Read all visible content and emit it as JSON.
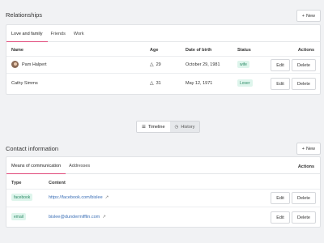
{
  "relationships": {
    "title": "Relationships",
    "new_label": "New",
    "tabs": [
      "Love and family",
      "Friends",
      "Work"
    ],
    "columns": [
      "Name",
      "Age",
      "Date of birth",
      "Status",
      "Actions"
    ],
    "rows": [
      {
        "name": "Pam Halpert",
        "age": "29",
        "dob": "October 29, 1981",
        "status": "wife",
        "edit": "Edit",
        "delete": "Delete"
      },
      {
        "name": "Cathy Simms",
        "age": "31",
        "dob": "May 12, 1971",
        "status": "Lover",
        "edit": "Edit",
        "delete": "Delete"
      }
    ]
  },
  "view_toggle": {
    "timeline": "Timeline",
    "history": "History"
  },
  "contact": {
    "title": "Contact information",
    "new_label": "New",
    "tabs": [
      "Means of communication",
      "Addresses"
    ],
    "actions_label": "Actions",
    "columns": [
      "Type",
      "Content"
    ],
    "rows": [
      {
        "type": "facebook",
        "content": "https://facebook.com/bislee",
        "edit": "Edit",
        "delete": "Delete"
      },
      {
        "type": "email",
        "content": "bislee@dundermifflin.com",
        "edit": "Edit",
        "delete": "Delete"
      }
    ]
  },
  "colors": {
    "accent": "#e0497a",
    "badge_bg": "#def5ec",
    "badge_text": "#2d8a66",
    "link": "#3b6fb6"
  }
}
